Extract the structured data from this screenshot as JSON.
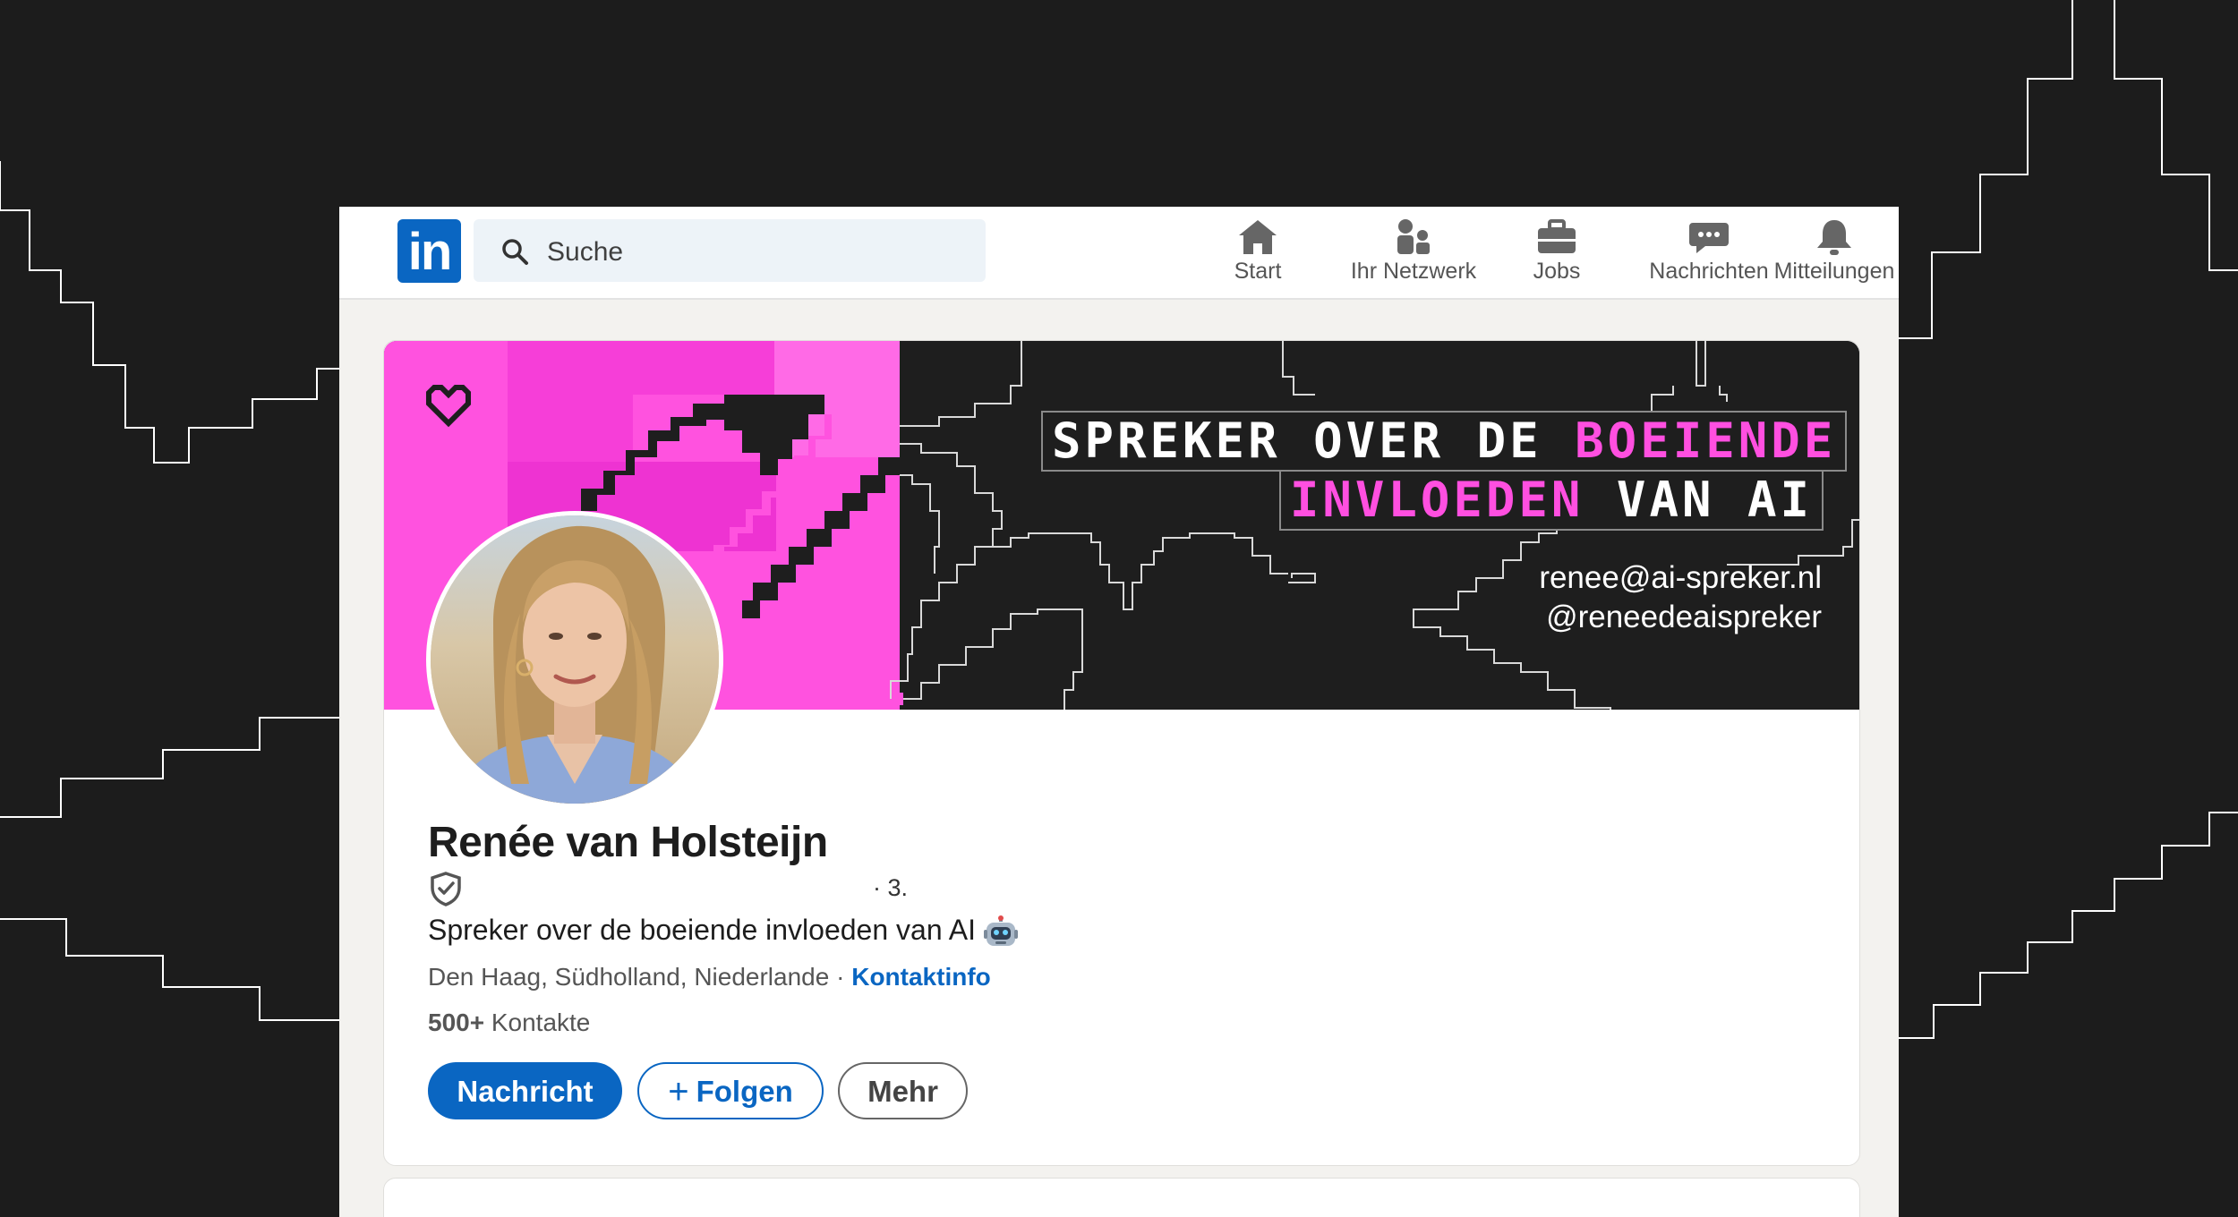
{
  "app": {
    "name": "LinkedIn"
  },
  "search": {
    "placeholder": "Suche"
  },
  "nav": {
    "items": [
      {
        "label": "Start",
        "icon": "home-icon"
      },
      {
        "label": "Ihr Netzwerk",
        "icon": "network-icon"
      },
      {
        "label": "Jobs",
        "icon": "briefcase-icon"
      },
      {
        "label": "Nachrichten",
        "icon": "messaging-icon"
      },
      {
        "label": "Mitteilungen",
        "icon": "bell-icon"
      }
    ]
  },
  "banner": {
    "title_line1_white": "SPREKER OVER DE ",
    "title_line1_pink": "BOEIENDE",
    "title_line2_pink": "INVLOEDEN",
    "title_line2_white": " VAN AI",
    "email": "renee@ai-spreker.nl",
    "handle": "@reneedeaispreker",
    "colors": {
      "pink": "#ff4fe0",
      "dark": "#1e1e1e"
    }
  },
  "profile": {
    "name": "Renée van Holsteijn",
    "degree": "· 3.",
    "headline": "Spreker over de boeiende invloeden van AI",
    "location": "Den Haag, Südholland, Niederlande",
    "location_sep": " · ",
    "contact_link": "Kontaktinfo",
    "connections_count": "500+",
    "connections_label": " Kontakte"
  },
  "actions": {
    "message": "Nachricht",
    "follow": "Folgen",
    "more": "Mehr"
  },
  "colors": {
    "brand": "#0a66c2",
    "page_bg": "#f3f2ef"
  }
}
